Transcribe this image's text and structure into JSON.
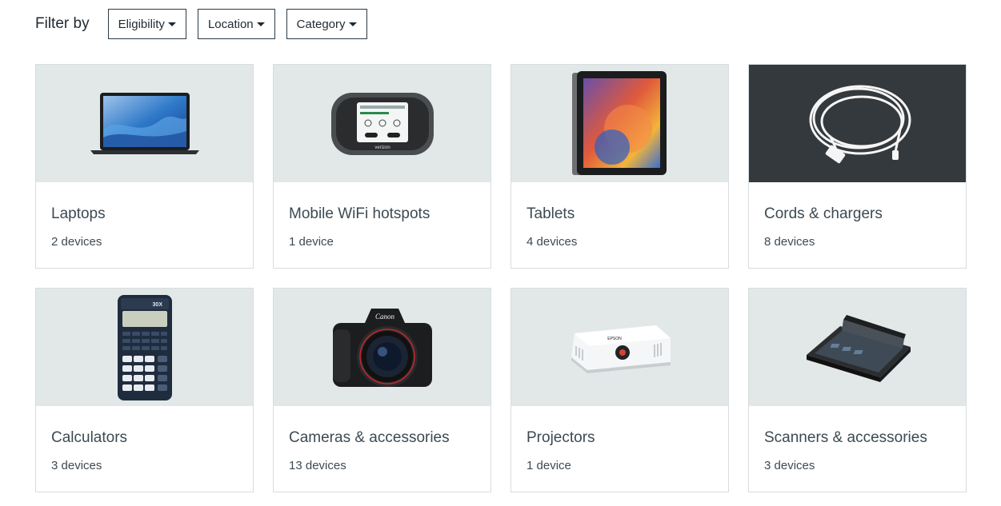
{
  "filters": {
    "label": "Filter by",
    "buttons": [
      {
        "label": "Eligibility"
      },
      {
        "label": "Location"
      },
      {
        "label": "Category"
      }
    ]
  },
  "categories": [
    {
      "title": "Laptops",
      "count": "2 devices",
      "image": "laptop-image"
    },
    {
      "title": "Mobile WiFi hotspots",
      "count": "1 device",
      "image": "hotspot-image"
    },
    {
      "title": "Tablets",
      "count": "4 devices",
      "image": "tablet-image"
    },
    {
      "title": "Cords & chargers",
      "count": "8 devices",
      "image": "cord-image"
    },
    {
      "title": "Calculators",
      "count": "3 devices",
      "image": "calculator-image"
    },
    {
      "title": "Cameras & accessories",
      "count": "13 devices",
      "image": "camera-image"
    },
    {
      "title": "Projectors",
      "count": "1 device",
      "image": "projector-image"
    },
    {
      "title": "Scanners & accessories",
      "count": "3 devices",
      "image": "scanner-image"
    }
  ],
  "images": {
    "hotspot_brand": "verizon",
    "camera_brand": "Canon",
    "projector_brand": "EPSON",
    "calculator_model": "30X"
  }
}
